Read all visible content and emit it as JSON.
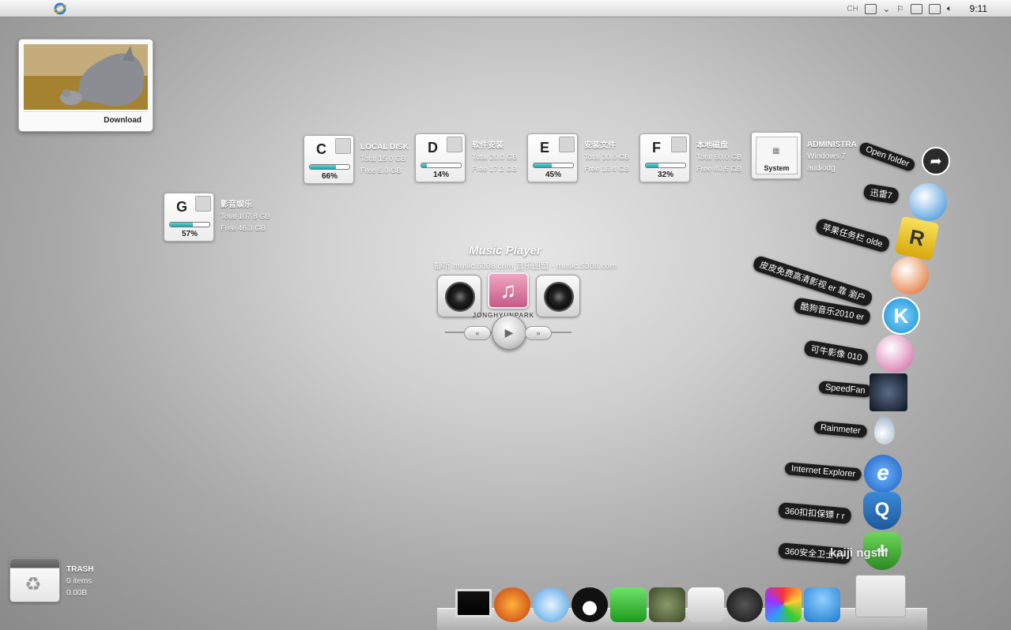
{
  "menubar": {
    "apple_glyph": "",
    "tray_label": "CH",
    "clock": "9:11"
  },
  "download_widget": {
    "label": "Download"
  },
  "drives": [
    {
      "letter": "C",
      "name": "LOCAL DISK",
      "total": "Total 15.0 GB",
      "free": "Free 5.0 GB",
      "percent_label": "66%",
      "percent": 66
    },
    {
      "letter": "D",
      "name": "软件安装",
      "total": "Total 20.0 GB",
      "free": "Free 17.2 GB",
      "percent_label": "14%",
      "percent": 14
    },
    {
      "letter": "E",
      "name": "安装文件",
      "total": "Total 30.0 GB",
      "free": "Free 16.4 GB",
      "percent_label": "45%",
      "percent": 45
    },
    {
      "letter": "F",
      "name": "本地磁盘",
      "total": "Total 60.0 GB",
      "free": "Free 40.5 GB",
      "percent_label": "32%",
      "percent": 32
    },
    {
      "letter": "G",
      "name": "影音娱乐",
      "total": "Total 107.8 GB",
      "free": "Free 46.3 GB",
      "percent_label": "57%",
      "percent": 57
    }
  ],
  "system": {
    "label": "System",
    "user": "ADMINISTRA",
    "os": "Windows 7",
    "process": "audiodg"
  },
  "music_player": {
    "title": "Music Player",
    "subtitle": "静听 music.5308.com 音乐图窗 - music.5308.com",
    "artist": "JONGHYUNPARK",
    "note_glyph": "♫",
    "prev_glyph": "«",
    "play_glyph": "▶",
    "next_glyph": "»"
  },
  "launcher": [
    {
      "label": "Open folder",
      "icon": "share-arrow-icon"
    },
    {
      "label": "迅雷7",
      "icon": "thunder-bird-icon"
    },
    {
      "label": "苹果任务栏 olde",
      "icon": "rocketdock-icon"
    },
    {
      "label": "皮皮免费高清影视 er 靠 瀏户",
      "icon": "pipi-player-icon"
    },
    {
      "label": "酷狗音乐2010 er",
      "icon": "kugou-icon"
    },
    {
      "label": "可牛影像 010",
      "icon": "keniu-cow-icon"
    },
    {
      "label": "SpeedFan",
      "icon": "fan-icon"
    },
    {
      "label": "Rainmeter",
      "icon": "raindrop-icon"
    },
    {
      "label": "Internet Explorer",
      "icon": "ie-icon"
    },
    {
      "label": "360扣扣保镖 r r",
      "icon": "qq-shield-icon"
    },
    {
      "label": "360安全卫士 r r",
      "icon": "360-shield-icon"
    }
  ],
  "launcher_watermark": "kaiji ngshi",
  "trash": {
    "name": "TRASH",
    "items": "0 items",
    "size": "0.00B"
  },
  "dock": [
    "monitor-icon",
    "firefox-icon",
    "itunes-icon",
    "qq-penguin-icon",
    "facetime-icon",
    "turtle-icon",
    "textedit-icon",
    "webcam-icon",
    "flower-icon",
    "mushroom-icon",
    "trash-dock-icon"
  ],
  "colors": {
    "drive_fill": "#23a3a8",
    "pill": "#1c1c1c",
    "background": "#b5b5b5"
  }
}
